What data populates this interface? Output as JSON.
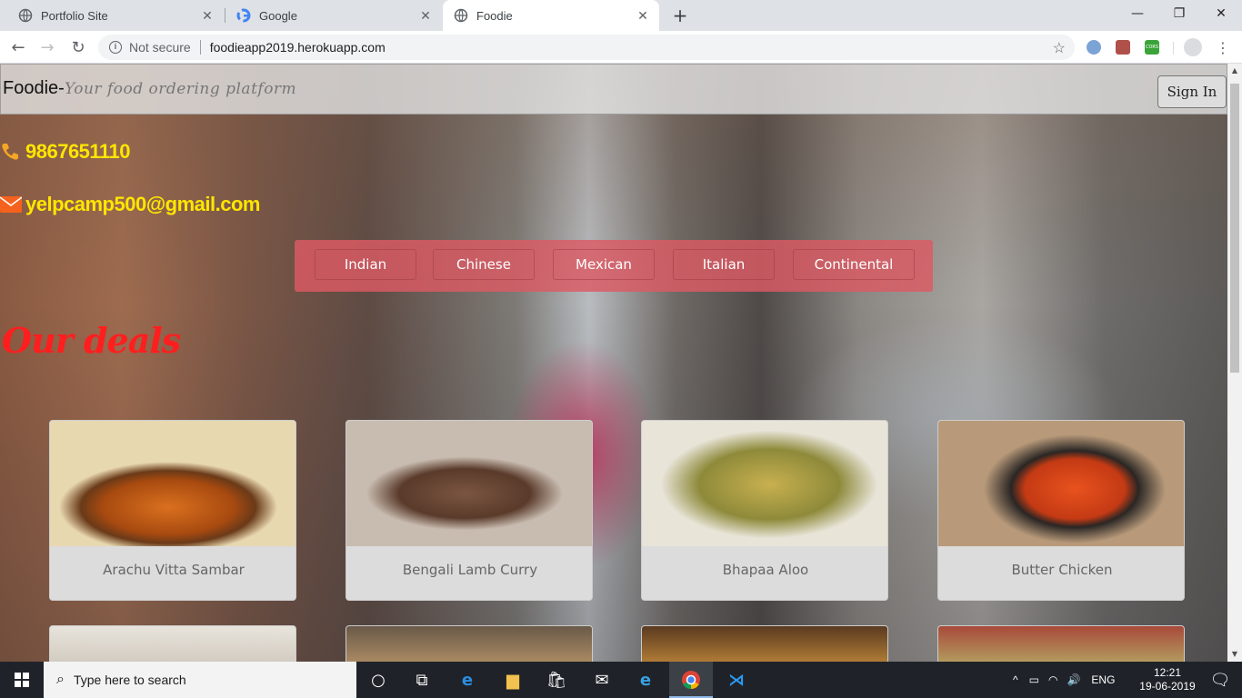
{
  "browser": {
    "tabs": [
      {
        "title": "Portfolio Site",
        "active": false
      },
      {
        "title": "Google",
        "active": false
      },
      {
        "title": "Foodie",
        "active": true
      }
    ],
    "security_label": "Not secure",
    "url": "foodieapp2019.herokuapp.com",
    "extensions": [
      "shield-extension-icon",
      "pdf-extension-icon",
      "cors-extension-icon"
    ],
    "cors_label": "CORS"
  },
  "navbar": {
    "brand": "Foodie-",
    "tagline": "Your food ordering platform",
    "signin_label": "Sign In"
  },
  "contact": {
    "phone": "9867651110",
    "email": "yelpcamp500@gmail.com"
  },
  "cuisines": [
    "Indian",
    "Chinese",
    "Mexican",
    "Italian",
    "Continental"
  ],
  "deals_heading": "Our deals",
  "deals": [
    {
      "name": "Arachu Vitta Sambar",
      "color": "#c9621c"
    },
    {
      "name": "Bengali Lamb Curry",
      "color": "#6b4a3a"
    },
    {
      "name": "Bhapaa Aloo",
      "color": "#b8a24a"
    },
    {
      "name": "Butter Chicken",
      "color": "#d9481e"
    }
  ],
  "deals_row2_colors": [
    "#d8d2c8",
    "#8a6a4a",
    "#c98a3a",
    "#a8b860"
  ],
  "taskbar": {
    "search_placeholder": "Type here to search",
    "language": "ENG",
    "time": "12:21",
    "date": "19-06-2019"
  },
  "colors": {
    "accent_red": "#ff1e1e",
    "contact_yellow": "#ffe600",
    "cuisine_bar": "#dc5a64"
  }
}
